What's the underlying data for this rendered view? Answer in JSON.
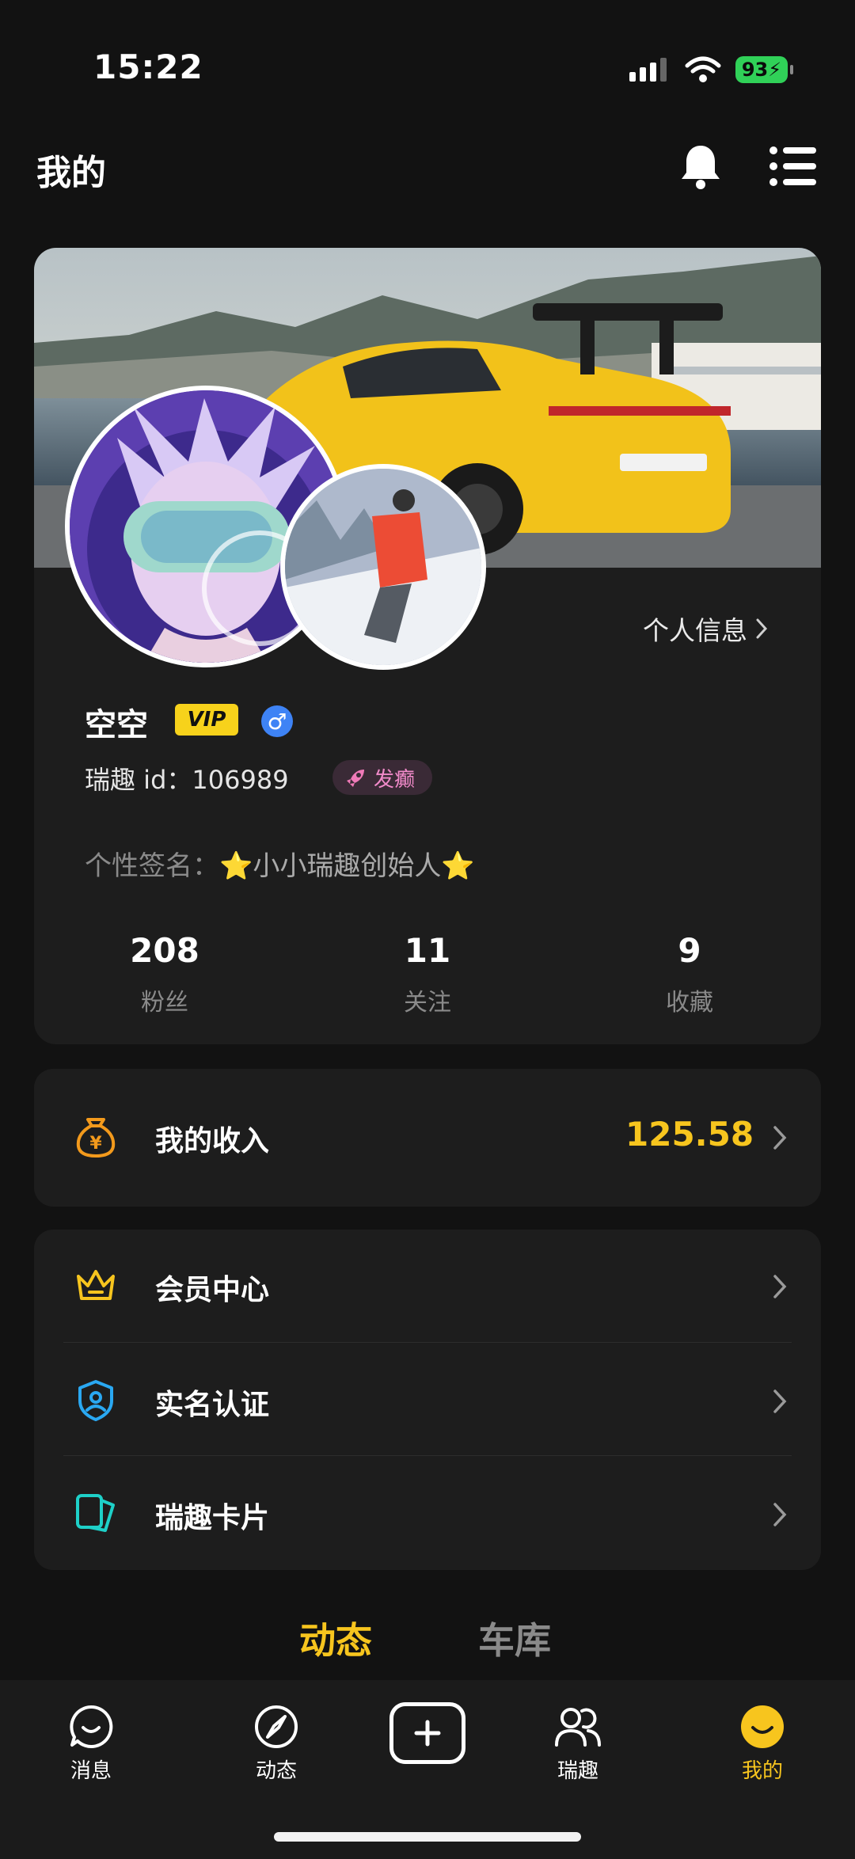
{
  "status_bar": {
    "time": "15:22",
    "battery": "93"
  },
  "header": {
    "title": "我的",
    "icons": [
      "bell-icon",
      "menu-icon"
    ]
  },
  "profile": {
    "profile_link": "个人信息",
    "username": "空空",
    "vip_badge": "VIP",
    "gender_symbol": "♂",
    "uid_label": "瑞趣 id：",
    "uid_value": "106989",
    "tag": "发癫",
    "signature_label": "个性签名：",
    "signature_value": "⭐小小瑞趣创始人⭐",
    "stats": [
      {
        "value": "208",
        "label": "粉丝"
      },
      {
        "value": "11",
        "label": "关注"
      },
      {
        "value": "9",
        "label": "收藏"
      }
    ]
  },
  "income": {
    "label": "我的收入",
    "value": "125.58"
  },
  "menu_items": [
    {
      "label": "会员中心",
      "icon": "crown-icon"
    },
    {
      "label": "实名认证",
      "icon": "shield-user-icon"
    },
    {
      "label": "瑞趣卡片",
      "icon": "cards-icon"
    }
  ],
  "tabs": [
    {
      "label": "动态",
      "active": true
    },
    {
      "label": "车库",
      "active": false
    }
  ],
  "bottom_nav": [
    {
      "label": "消息",
      "icon": "chat-icon"
    },
    {
      "label": "动态",
      "icon": "compass-icon"
    },
    {
      "label": "",
      "icon": "add-icon"
    },
    {
      "label": "瑞趣",
      "icon": "group-icon"
    },
    {
      "label": "我的",
      "icon": "smile-icon",
      "active": true
    }
  ],
  "colors": {
    "accent": "#f7c51e",
    "background": "#121212",
    "card": "#1d1d1d",
    "vip": "#f7d21b"
  }
}
